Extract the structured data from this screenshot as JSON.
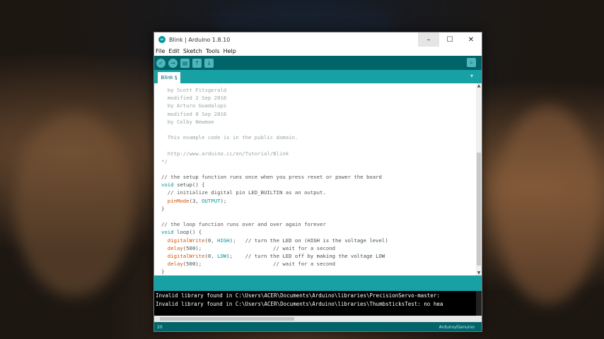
{
  "window": {
    "title": "Blink | Arduino 1.8.10",
    "app_icon": "∞"
  },
  "window_controls": {
    "minimize": "–",
    "maximize": "☐",
    "close": "✕"
  },
  "menu": [
    "File",
    "Edit",
    "Sketch",
    "Tools",
    "Help"
  ],
  "toolbar": {
    "verify": "✓",
    "upload": "→",
    "new": "▤",
    "open": "↑",
    "save": "↓",
    "serial_monitor": "⌕"
  },
  "tab": {
    "label": "Blink §",
    "menu_arrow": "▾"
  },
  "code": [
    [
      {
        "t": "  by Scott Fitzgerald",
        "c": "comment"
      }
    ],
    [
      {
        "t": "  modified 2 Sep 2016",
        "c": "comment"
      }
    ],
    [
      {
        "t": "  by Arturo Guadalupi",
        "c": "comment"
      }
    ],
    [
      {
        "t": "  modified 8 Sep 2016",
        "c": "comment"
      }
    ],
    [
      {
        "t": "  by Colby Newman",
        "c": "comment"
      }
    ],
    [
      {
        "t": "",
        "c": "comment"
      }
    ],
    [
      {
        "t": "  This example code is in the public domain.",
        "c": "comment"
      }
    ],
    [
      {
        "t": "",
        "c": "comment"
      }
    ],
    [
      {
        "t": "  http://www.arduino.cc/en/Tutorial/Blink",
        "c": "comment"
      }
    ],
    [
      {
        "t": "*/",
        "c": "comment"
      }
    ],
    [
      {
        "t": "",
        "c": "plain"
      }
    ],
    [
      {
        "t": "// the setup function runs once when you press reset or power the board",
        "c": "comment-dark"
      }
    ],
    [
      {
        "t": "void",
        "c": "kw"
      },
      {
        "t": " setup() {",
        "c": "plain"
      }
    ],
    [
      {
        "t": "  // initialize digital pin LED_BUILTIN as an output.",
        "c": "comment-dark"
      }
    ],
    [
      {
        "t": "  ",
        "c": "plain"
      },
      {
        "t": "pinMode",
        "c": "fn"
      },
      {
        "t": "(3, ",
        "c": "plain"
      },
      {
        "t": "OUTPUT",
        "c": "const"
      },
      {
        "t": ");",
        "c": "plain"
      }
    ],
    [
      {
        "t": "}",
        "c": "plain"
      }
    ],
    [
      {
        "t": "",
        "c": "plain"
      }
    ],
    [
      {
        "t": "// the loop function runs over and over again forever",
        "c": "comment-dark"
      }
    ],
    [
      {
        "t": "void",
        "c": "kw"
      },
      {
        "t": " loop() {",
        "c": "plain"
      }
    ],
    [
      {
        "t": "  ",
        "c": "plain"
      },
      {
        "t": "digitalWrite",
        "c": "fn"
      },
      {
        "t": "(0, ",
        "c": "plain"
      },
      {
        "t": "HIGH",
        "c": "const"
      },
      {
        "t": ");   // turn the LED on (HIGH is the voltage level)",
        "c": "plain"
      }
    ],
    [
      {
        "t": "  ",
        "c": "plain"
      },
      {
        "t": "delay",
        "c": "fn"
      },
      {
        "t": "(500);",
        "c": "plain"
      },
      {
        "t": "                       // wait for a second",
        "c": "comment-dark"
      }
    ],
    [
      {
        "t": "  ",
        "c": "plain"
      },
      {
        "t": "digitalWrite",
        "c": "fn"
      },
      {
        "t": "(0, ",
        "c": "plain"
      },
      {
        "t": "LOW",
        "c": "const"
      },
      {
        "t": ");    // turn the LED off by making the voltage LOW",
        "c": "plain"
      }
    ],
    [
      {
        "t": "  ",
        "c": "plain"
      },
      {
        "t": "delay",
        "c": "fn"
      },
      {
        "t": "(500);",
        "c": "plain"
      },
      {
        "t": "                       // wait for a second",
        "c": "comment-dark"
      }
    ],
    [
      {
        "t": "}",
        "c": "plain"
      }
    ]
  ],
  "console": [
    "Invalid library found in C:\\Users\\ACER\\Documents\\Arduino\\libraries\\PrecisionServo-master:",
    "Invalid library found in C:\\Users\\ACER\\Documents\\Arduino\\libraries\\ThumbsticksTest: no hea"
  ],
  "status": {
    "line_number": "20",
    "board": "Arduino/Genuino"
  },
  "colors": {
    "teal_dark": "#006468",
    "teal": "#17a1a5",
    "keyword": "#00979c",
    "function": "#d35400"
  }
}
